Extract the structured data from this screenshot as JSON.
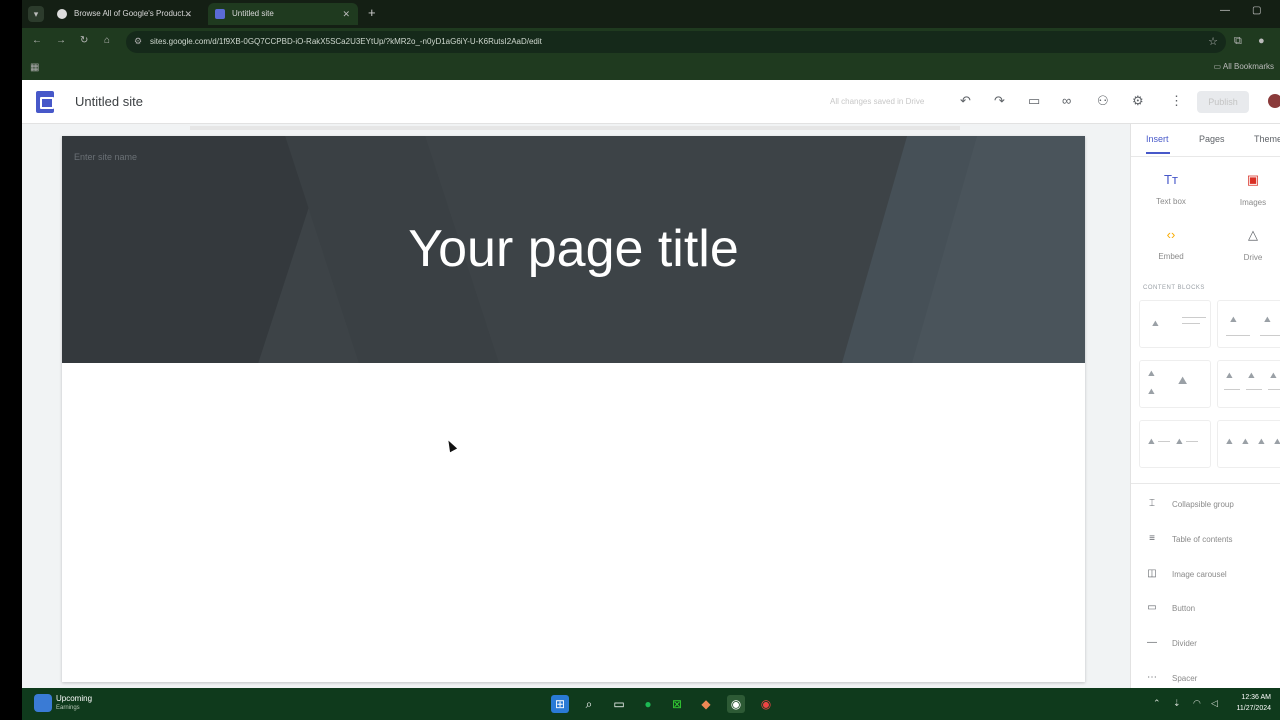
{
  "browser": {
    "tabs": [
      {
        "label": "Browse All of Google's Product..."
      },
      {
        "label": "Untitled site"
      }
    ],
    "new_tab": "+",
    "url": "sites.google.com/d/1f9XB-0GQ7CCPBD-iO-RakX5SCa2U3EYtUp/?kMR2o_-n0yD1aG6iY-U-K6RutsI2AaD/edit",
    "all_bookmarks": "All Bookmarks"
  },
  "app": {
    "title": "Untitled site",
    "save_status": "All changes saved in Drive",
    "publish_label": "Publish"
  },
  "page": {
    "site_name_placeholder": "Enter site name",
    "title": "Your page title"
  },
  "panel": {
    "tabs": [
      "Insert",
      "Pages",
      "Themes"
    ],
    "insert_items": [
      {
        "label": "Text box",
        "icon": "text-box-icon",
        "color": "#4758c9",
        "glyph": "Tт"
      },
      {
        "label": "Images",
        "icon": "image-icon",
        "color": "#d93025",
        "glyph": "▣"
      },
      {
        "label": "Embed",
        "icon": "embed-icon",
        "color": "#f9ab00",
        "glyph": "‹›"
      },
      {
        "label": "Drive",
        "icon": "drive-icon",
        "color": "#5f6368",
        "glyph": "△"
      }
    ],
    "content_blocks_label": "CONTENT BLOCKS",
    "list_items": [
      {
        "label": "Collapsible group",
        "icon": "collapsible-group-icon",
        "glyph": "⌶"
      },
      {
        "label": "Table of contents",
        "icon": "table-of-contents-icon",
        "glyph": "≡"
      },
      {
        "label": "Image carousel",
        "icon": "image-carousel-icon",
        "glyph": "◫"
      },
      {
        "label": "Button",
        "icon": "button-icon",
        "glyph": "▭"
      },
      {
        "label": "Divider",
        "icon": "divider-icon",
        "glyph": "—"
      },
      {
        "label": "Spacer",
        "icon": "spacer-icon",
        "glyph": "⋯"
      }
    ]
  },
  "taskbar": {
    "weather_title": "Upcoming",
    "weather_sub": "Earnings",
    "time": "12:36 AM",
    "date": "11/27/2024"
  },
  "colors": {
    "accent": "#4758c9",
    "header_bg": "#3d4347",
    "taskbar_bg": "#0f3a1c"
  }
}
